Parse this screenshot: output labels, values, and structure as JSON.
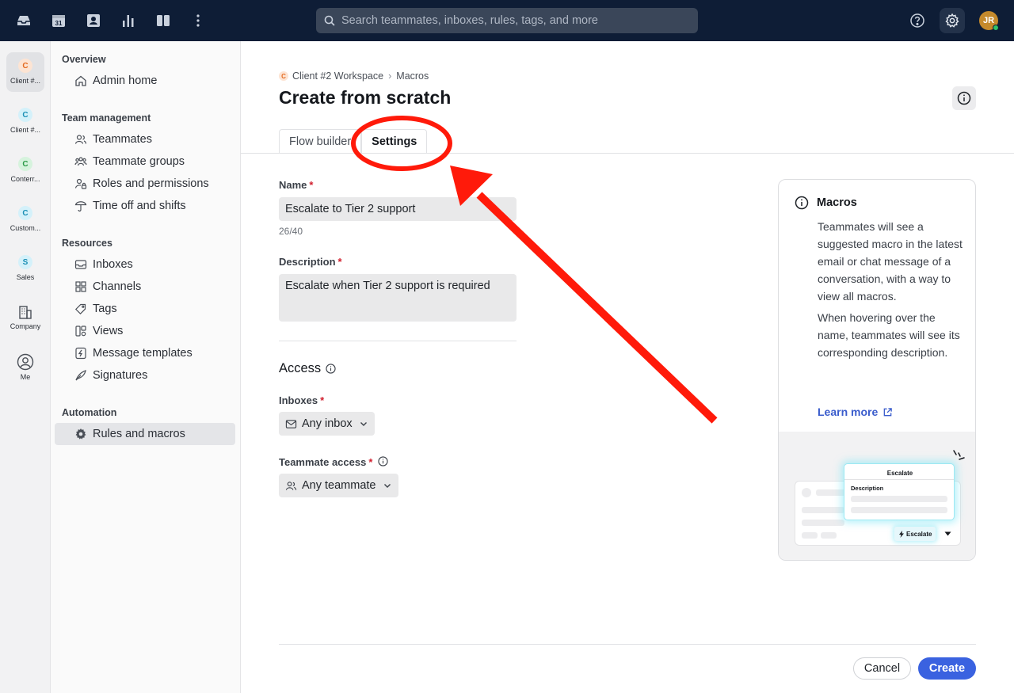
{
  "topbar": {
    "search_placeholder": "Search teammates, inboxes, rules, tags, and more",
    "calendar_day": "31",
    "user_initials": "JR"
  },
  "rail": [
    {
      "badge": "C",
      "label": "Client #...",
      "badge_bg": "#fde4d3",
      "badge_color": "#e46a1f",
      "active": true
    },
    {
      "badge": "C",
      "label": "Client #...",
      "badge_bg": "#d4f1fa",
      "badge_color": "#1a8fb5",
      "active": false
    },
    {
      "badge": "C",
      "label": "Conterr...",
      "badge_bg": "#d6f3dd",
      "badge_color": "#2a9a47",
      "active": false
    },
    {
      "badge": "C",
      "label": "Custom...",
      "badge_bg": "#d4f1fa",
      "badge_color": "#1a8fb5",
      "active": false
    },
    {
      "badge": "S",
      "label": "Sales",
      "badge_bg": "#d4f1fa",
      "badge_color": "#1a8fb5",
      "active": false
    },
    {
      "badge": "",
      "label": "Company",
      "active": false
    },
    {
      "badge": "",
      "label": "Me",
      "active": false
    }
  ],
  "nav": {
    "overview": "Overview",
    "admin_home": "Admin home",
    "team_management": "Team management",
    "teammates": "Teammates",
    "teammate_groups": "Teammate groups",
    "roles_permissions": "Roles and permissions",
    "time_off": "Time off and shifts",
    "resources": "Resources",
    "inboxes": "Inboxes",
    "channels": "Channels",
    "tags": "Tags",
    "views": "Views",
    "message_templates": "Message templates",
    "signatures": "Signatures",
    "automation": "Automation",
    "rules_macros": "Rules and macros"
  },
  "breadcrumb": {
    "badge": "C",
    "workspace": "Client #2 Workspace",
    "separator": "›",
    "current": "Macros"
  },
  "page": {
    "title": "Create from scratch",
    "tabs": [
      "Flow builder",
      "Settings"
    ]
  },
  "form": {
    "name_label": "Name",
    "name_value": "Escalate to Tier 2 support",
    "name_counter": "26/40",
    "description_label": "Description",
    "description_value": "Escalate when Tier 2 support is required",
    "access_title": "Access",
    "inboxes_label": "Inboxes",
    "inboxes_value": "Any inbox",
    "teammate_access_label": "Teammate access",
    "teammate_access_value": "Any teammate",
    "required_mark": "*"
  },
  "card": {
    "title": "Macros",
    "paragraph1": "Teammates will see a suggested macro in the latest email or chat message of a conversation, with a way to view all macros.",
    "paragraph2": "When hovering over the name, teammates will see its corresponding description.",
    "learn_more": "Learn more",
    "illustration": {
      "popup_title": "Escalate",
      "popup_description": "Description",
      "button_label": "Escalate"
    }
  },
  "footer": {
    "cancel": "Cancel",
    "create": "Create"
  },
  "colors": {
    "topbar": "#0e1d36",
    "primary": "#3a62e0",
    "annotation": "#ff1a0a"
  }
}
